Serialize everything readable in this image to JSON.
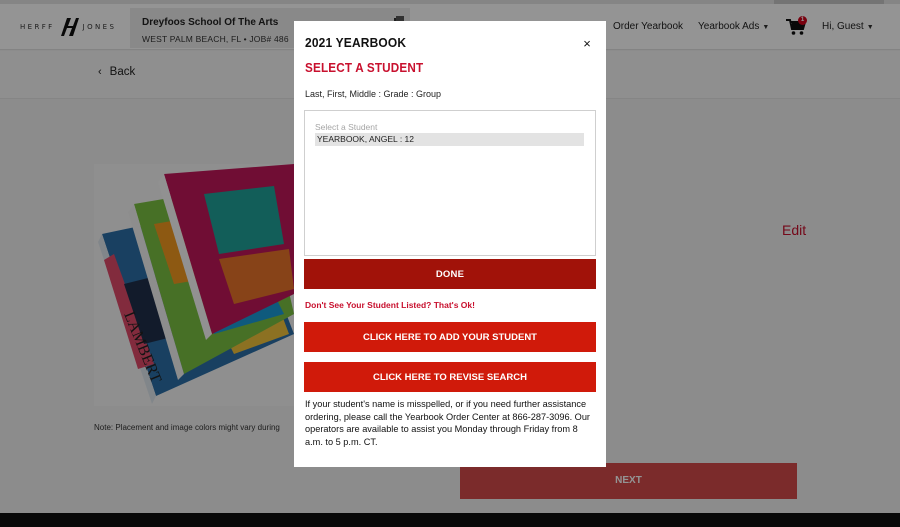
{
  "header": {
    "logo_left": "HERFF",
    "logo_right": "JONES",
    "school_name": "Dreyfoos School Of The Arts",
    "school_location": "WEST PALM BEACH, FL • JOB# 486",
    "nav": {
      "order_yearbook": "Order Yearbook",
      "yearbook_ads": "Yearbook Ads",
      "cart_count": "1",
      "greeting": "Hi, Guest"
    }
  },
  "page": {
    "back_label": "Back",
    "image_note": "Note: Placement and image colors might vary during",
    "edit_label": "Edit",
    "next_label": "NEXT"
  },
  "modal": {
    "title": "2021 YEARBOOK",
    "close_glyph": "×",
    "subtitle": "SELECT A STUDENT",
    "format_hint": "Last, First, Middle : Grade : Group",
    "list_placeholder": "Select a Student",
    "students": [
      "YEARBOOK, ANGEL : 12"
    ],
    "done_label": "DONE",
    "missing_prompt": "Don't See Your Student Listed? That's Ok!",
    "add_label": "CLICK HERE TO ADD YOUR STUDENT",
    "revise_label": "CLICK HERE TO REVISE SEARCH",
    "info_text": "If your student's name is misspelled, or if you need further assistance ordering, please call the Yearbook Order Center at 866-287-3096. Our operators are available to assist you Monday through Friday from 8 a.m. to 5 p.m. CT."
  },
  "colors": {
    "brand_red": "#c8102e",
    "done_button": "#a11209",
    "action_button": "#d01a0a",
    "next_button_dimmed": "#d44b4b"
  },
  "icons": {
    "back": "chevron-left-icon",
    "close": "close-icon",
    "cart": "cart-icon",
    "school": "document-icon",
    "dropdown": "caret-down-icon"
  }
}
